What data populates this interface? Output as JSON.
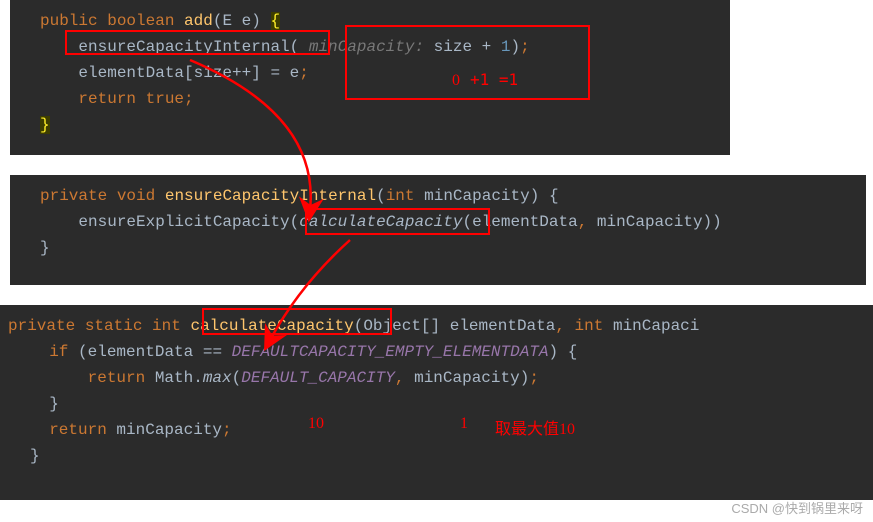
{
  "block1": {
    "l1": {
      "kw1": "public",
      "type": "boolean",
      "method": "add",
      "paren": "(",
      "ident": "E e",
      "cparen": ")",
      "brace": "{"
    },
    "l2": {
      "call": "ensureCapacityInternal",
      "paren": "(",
      "hint": " minCapacity: ",
      "expr": "size + ",
      "num": "1",
      "cparen": ")",
      "semi": ";"
    },
    "l3": {
      "a": "elementData[size",
      "op": "++",
      "b": "] = e",
      "semi": ";"
    },
    "l4": {
      "kw": "return",
      "val": "true",
      "semi": ";"
    },
    "l5": {
      "brace": "}"
    }
  },
  "block2": {
    "l1": {
      "kw1": "private",
      "kw2": "void",
      "method": "ensureCapacityInternal",
      "paren": "(",
      "type": "int",
      "param": "minCapacity",
      "cparen": ")",
      "brace": "{"
    },
    "l2": {
      "call1": "ensureExplicitCapacity",
      "p1": "(",
      "call2": "calculateCapacity",
      "p2": "(",
      "a1": "elementData",
      "c": ",",
      "a2": " minCapacity",
      "cp": "))"
    },
    "l3": {
      "brace": "}"
    }
  },
  "block3": {
    "l1": {
      "kw1": "private",
      "kw2": "static",
      "type": "int",
      "method": "calculateCapacity",
      "paren": "(",
      "t1": "Object[]",
      "a1": " elementData",
      "c": ",",
      "t2": " int",
      "a2": " minCapaci"
    },
    "l2": {
      "kw": "if",
      "p": "(",
      "a": "elementData ",
      "op": "==",
      "const": " DEFAULTCAPACITY_EMPTY_ELEMENTDATA",
      "cp": ")",
      "brace": "{"
    },
    "l3": {
      "kw": "return",
      "cls": " Math.",
      "m": "max",
      "p": "(",
      "const": "DEFAULT_CAPACITY",
      "c": ",",
      "a": " minCapacity",
      "cp": ")",
      "semi": ";"
    },
    "l4": {
      "brace": "}"
    },
    "l5": {
      "kw": "return",
      "a": " minCapacity",
      "semi": ";"
    },
    "l6": {
      "brace": "}"
    }
  },
  "anno": {
    "a1": "0",
    "a2": "+1  =1",
    "a3": "10",
    "a4": "1",
    "a5": "取最大值10"
  },
  "watermark": "CSDN @快到锅里来呀"
}
